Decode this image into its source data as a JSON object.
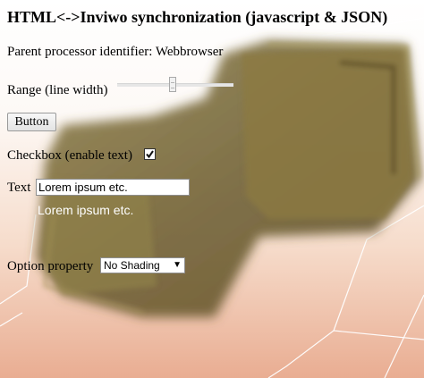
{
  "page": {
    "title": "HTML<->Inviwo synchronization (javascript & JSON)",
    "parent_label": "Parent processor identifier: Webbrowser"
  },
  "range": {
    "label": "Range (line width)",
    "value_fraction": 0.48
  },
  "button": {
    "label": "Button"
  },
  "checkbox": {
    "label": "Checkbox (enable text)",
    "checked": true
  },
  "text": {
    "label": "Text",
    "value": "Lorem ipsum etc.",
    "echo": "Lorem ipsum etc."
  },
  "option": {
    "label": "Option property",
    "selected": "No Shading"
  }
}
